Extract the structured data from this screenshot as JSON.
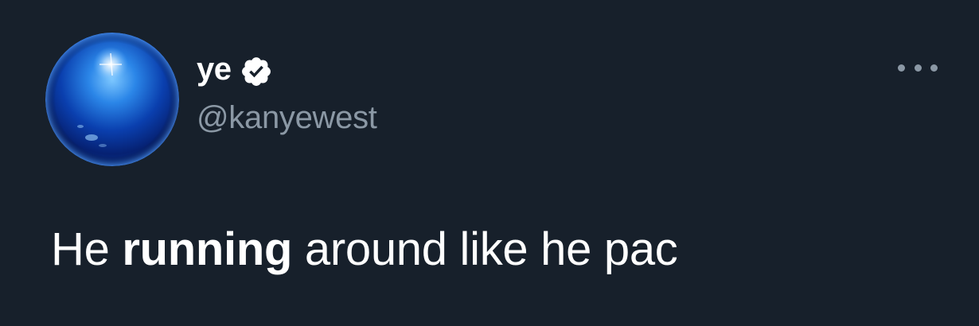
{
  "tweet": {
    "author": {
      "display_name": "ye",
      "handle": "@kanyewest",
      "verified": true,
      "avatar_icon": "blue-sphere-avatar"
    },
    "more_icon": "more-horizontal-icon",
    "text_parts": [
      "He ",
      "running",
      " around like he pac"
    ],
    "text_bold_part": "running"
  },
  "colors": {
    "background": "#17202b",
    "primary_text": "#ffffff",
    "secondary_text": "#8b98a5"
  }
}
